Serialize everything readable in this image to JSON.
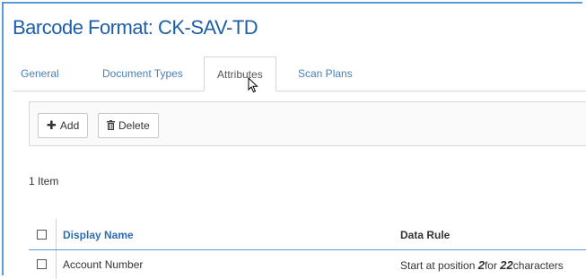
{
  "page_title": "Barcode Format: CK-SAV-TD",
  "tabs": [
    {
      "label": "General"
    },
    {
      "label": "Document Types"
    },
    {
      "label": "Attributes"
    },
    {
      "label": "Scan Plans"
    }
  ],
  "toolbar": {
    "add_label": "Add",
    "delete_label": "Delete",
    "add_icon": "plus-icon",
    "delete_icon": "trash-icon"
  },
  "item_count": "1 Item",
  "table": {
    "columns": [
      "Display Name",
      "Data Rule"
    ],
    "rows": [
      {
        "display_name": "Account Number",
        "rule_prefix": "Start at position ",
        "rule_position": "2",
        "rule_mid": "for ",
        "rule_length": "22",
        "rule_suffix": "characters"
      }
    ]
  },
  "colors": {
    "title": "#1f5fa6",
    "tab_link": "#4a7fb8",
    "header_link": "#2e6db4",
    "frame": "#5b9bd5"
  }
}
